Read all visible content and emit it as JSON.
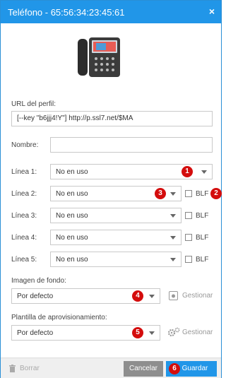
{
  "dialog": {
    "title": "Teléfono - 65:56:34:23:45:61",
    "close_icon": "×"
  },
  "profile": {
    "label": "URL del perfil:",
    "value": "[--key \"b6jjj4!Y\"] http://p.ssl7.net/$MA"
  },
  "name": {
    "label": "Nombre:",
    "value": ""
  },
  "lines": [
    {
      "label": "Línea 1:",
      "value": "No en uso",
      "has_blf": false
    },
    {
      "label": "Línea 2:",
      "value": "No en uso",
      "has_blf": true,
      "blf_label": "BLF"
    },
    {
      "label": "Línea 3:",
      "value": "No en uso",
      "has_blf": true,
      "blf_label": "BLF"
    },
    {
      "label": "Línea 4:",
      "value": "No en uso",
      "has_blf": true,
      "blf_label": "BLF"
    },
    {
      "label": "Línea 5:",
      "value": "No en uso",
      "has_blf": true,
      "blf_label": "BLF"
    }
  ],
  "background": {
    "label": "Imagen de fondo:",
    "value": "Por defecto",
    "manage_label": "Gestionar"
  },
  "provisioning": {
    "label": "Plantilla de aprovisionamiento:",
    "value": "Por defecto",
    "manage_label": "Gestionar"
  },
  "footer": {
    "delete_label": "Borrar",
    "cancel_label": "Cancelar",
    "save_label": "Guardar"
  },
  "badges": [
    "1",
    "2",
    "3",
    "4",
    "5",
    "6"
  ],
  "colors": {
    "accent": "#2196e8",
    "badge": "#d40d0d",
    "cancel": "#8e8e8e"
  }
}
